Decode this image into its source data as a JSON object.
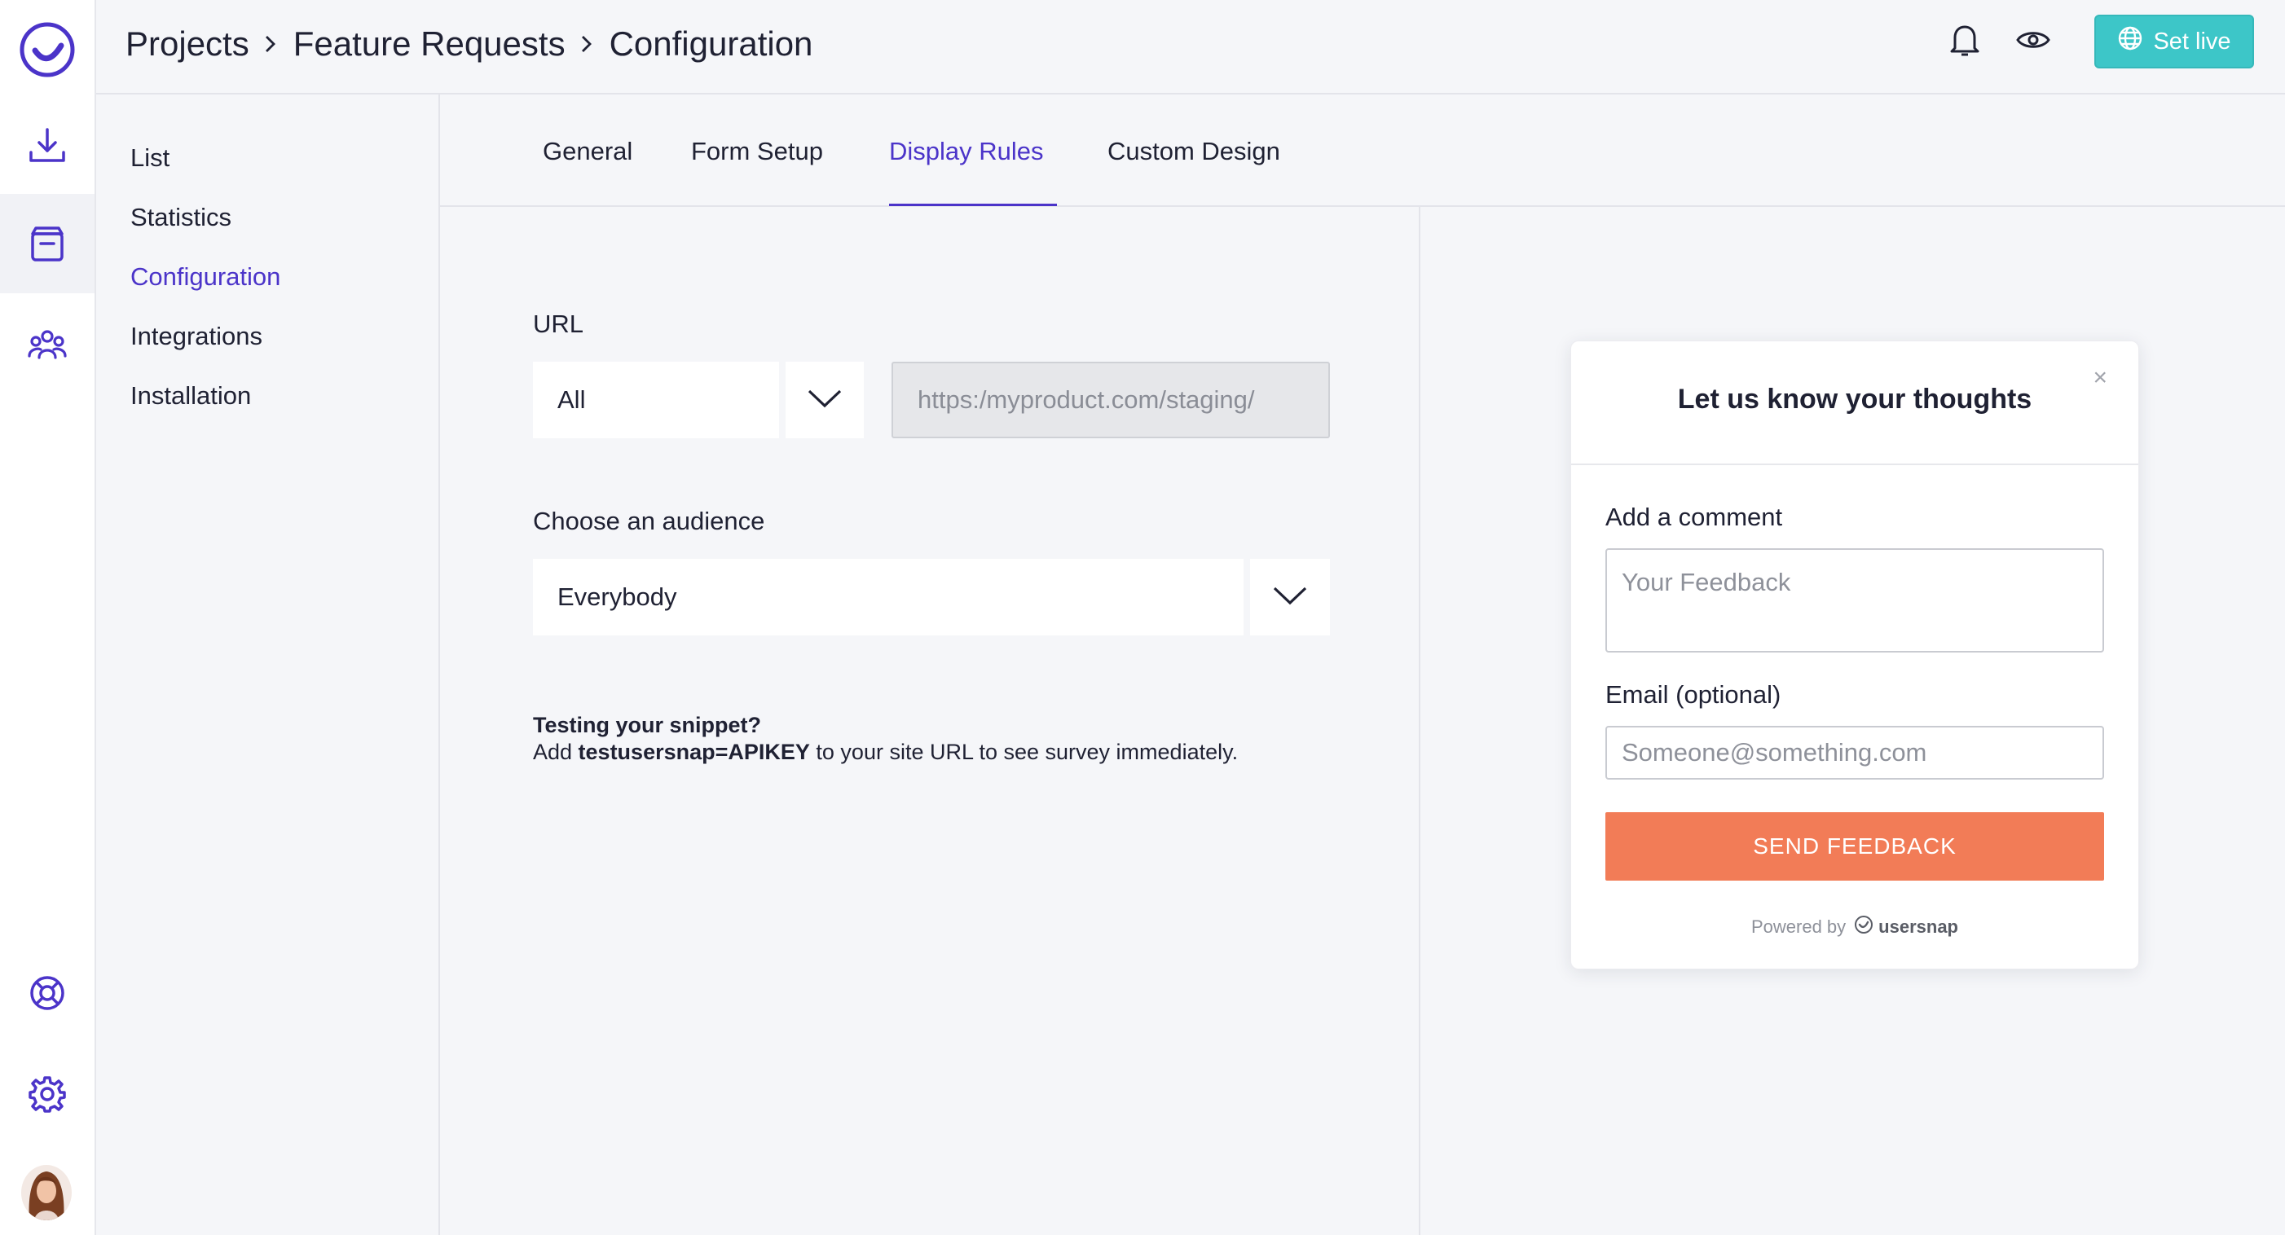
{
  "breadcrumb": {
    "items": [
      "Projects",
      "Feature Requests",
      "Configuration"
    ]
  },
  "header": {
    "set_live_label": "Set live"
  },
  "sidebar_nav": {
    "items": [
      {
        "label": "List"
      },
      {
        "label": "Statistics"
      },
      {
        "label": "Configuration",
        "active": true
      },
      {
        "label": "Integrations"
      },
      {
        "label": "Installation"
      }
    ]
  },
  "tabs": [
    {
      "label": "General"
    },
    {
      "label": "Form Setup"
    },
    {
      "label": "Display Rules",
      "active": true
    },
    {
      "label": "Custom Design"
    }
  ],
  "rules": {
    "url_label": "URL",
    "url_match_value": "All",
    "url_input_placeholder": "https:/myproduct.com/staging/",
    "audience_label": "Choose an audience",
    "audience_value": "Everybody",
    "hint_title": "Testing your snippet?",
    "hint_prefix": "Add ",
    "hint_code": "testusersnap=APIKEY",
    "hint_suffix": " to your site URL to see survey immediately."
  },
  "preview": {
    "close_symbol": "×",
    "title": "Let us know your thoughts",
    "comment_label": "Add a comment",
    "comment_placeholder": "Your Feedback",
    "email_label": "Email (optional)",
    "email_placeholder": "Someone@something.com",
    "button_label": "SEND FEEDBACK",
    "powered_by_label": "Powered by",
    "brand_name": "usersnap"
  },
  "colors": {
    "accent": "#4b34c9",
    "set_live": "#3dc6c8",
    "send_button": "#f27c57"
  },
  "icons": {
    "rail": [
      "logo-icon",
      "download-icon",
      "inbox-icon",
      "users-icon",
      "lifebuoy-icon",
      "gear-icon"
    ],
    "header": [
      "bell-icon",
      "eye-icon",
      "globe-icon"
    ]
  }
}
